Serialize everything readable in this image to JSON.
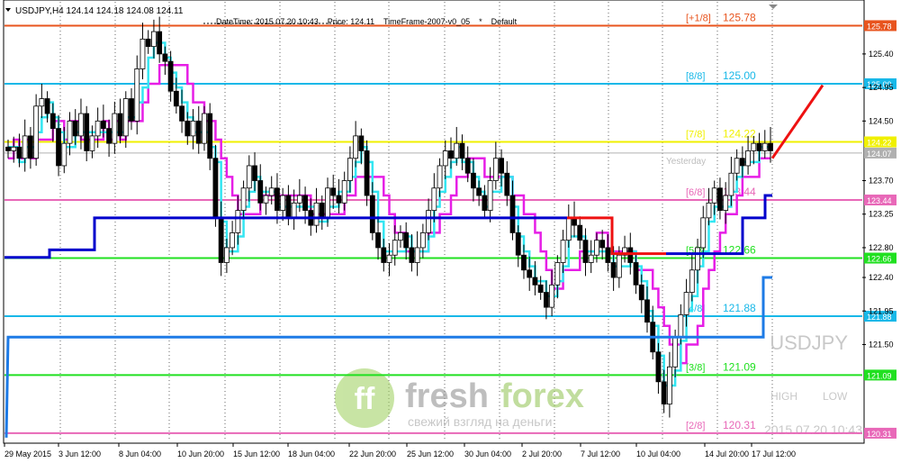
{
  "header": {
    "symbol_line": "USDJPY,H4  124.14 124.18 124.08 124.11",
    "info": "DateTime: 2015.07.20 10:43    Price: 124.11    TimeFrame-2007-v0_05    *    Default"
  },
  "watermark": {
    "symbol": "USDJPY",
    "high_label": "HIGH",
    "low_label": "LOW",
    "timestamp": "2015.07.20 10:43"
  },
  "brand": {
    "logo_text": "ff",
    "name_a": "fresh",
    "name_b": "forex",
    "tagline": "свежий взгляд на деньги"
  },
  "colors": {
    "up_candle": "#ffffff",
    "down_candle": "#000000",
    "fast_line": "#33e6f2",
    "slow_line": "#e61ee6",
    "blue_step": "#0000cc",
    "red_step": "#ee1111",
    "blue_upper": "#1e7be6",
    "projection": "#ee1111"
  },
  "chart_data": {
    "type": "candlestick",
    "symbol": "USDJPY",
    "timeframe": "H4",
    "ylim": [
      120.2,
      126.1
    ],
    "y_ticks": [
      125.4,
      124.95,
      124.5,
      123.7,
      123.25,
      122.8,
      122.4,
      121.95,
      121.5
    ],
    "x_ticks": [
      "29 May 2015",
      "3 Jun 12:00",
      "8 Jun 04:00",
      "10 Jun 20:00",
      "15 Jun 12:00",
      "18 Jun 04:00",
      "22 Jun 20:00",
      "25 Jun 12:00",
      "30 Jun 04:00",
      "2 Jul 20:00",
      "7 Jul 12:00",
      "10 Jul 04:00",
      "14 Jul 20:00",
      "17 Jul 12:00"
    ],
    "murrey_levels": [
      {
        "label": "[+1/8]",
        "value": 125.78,
        "axis_label": "125.78",
        "color": "#e8541e"
      },
      {
        "label": "[8/8]",
        "value": 125.0,
        "axis_label": "125.00",
        "color": "#18b8e8"
      },
      {
        "label": "[7/8]",
        "value": 124.22,
        "axis_label": "124.22",
        "color": "#f0f000"
      },
      {
        "label": "[6/8]",
        "value": 123.44,
        "axis_label": "123.44",
        "color": "#e868b8"
      },
      {
        "label": "[5/8]",
        "value": 122.66,
        "axis_label": "122.66",
        "color": "#20e020"
      },
      {
        "label": "[4/8]",
        "value": 121.88,
        "axis_label": "121.88",
        "color": "#18b8e8"
      },
      {
        "label": "[3/8]",
        "value": 121.09,
        "axis_label": "121.09",
        "color": "#20e020"
      },
      {
        "label": "[2/8]",
        "value": 120.31,
        "axis_label": "120.31",
        "color": "#e868b8"
      }
    ],
    "current_price": 124.07,
    "current_price_label": "124.07",
    "yesterday_label": "Yesterday",
    "closes": [
      124.1,
      124.15,
      124.0,
      124.3,
      124.0,
      124.7,
      124.8,
      124.6,
      124.4,
      123.9,
      124.2,
      124.5,
      124.3,
      124.6,
      124.1,
      124.3,
      124.5,
      124.4,
      124.2,
      124.6,
      124.3,
      124.8,
      124.5,
      125.2,
      125.6,
      125.5,
      125.7,
      125.4,
      125.3,
      124.9,
      124.7,
      124.5,
      124.3,
      124.5,
      124.2,
      124.6,
      124.0,
      123.2,
      122.6,
      122.8,
      123.0,
      123.3,
      123.6,
      123.9,
      123.7,
      123.4,
      123.5,
      123.6,
      123.3,
      123.5,
      123.2,
      123.4,
      123.5,
      123.3,
      123.1,
      123.4,
      123.2,
      123.6,
      123.5,
      123.4,
      123.7,
      124.0,
      124.3,
      124.1,
      123.5,
      123.0,
      122.8,
      122.6,
      122.7,
      122.9,
      123.0,
      122.8,
      122.6,
      122.8,
      123.0,
      123.3,
      123.6,
      123.9,
      124.1,
      124.0,
      124.2,
      124.0,
      123.8,
      123.6,
      123.5,
      123.3,
      123.7,
      124.0,
      123.8,
      123.5,
      123.0,
      122.7,
      122.5,
      122.4,
      122.3,
      122.2,
      122.0,
      122.3,
      122.6,
      122.9,
      123.2,
      123.1,
      122.9,
      122.6,
      122.7,
      122.9,
      122.8,
      122.6,
      122.4,
      122.7,
      122.8,
      122.6,
      122.3,
      122.1,
      121.8,
      121.4,
      121.0,
      120.7,
      121.2,
      121.6,
      121.9,
      122.2,
      122.5,
      122.8,
      123.2,
      123.4,
      123.6,
      123.3,
      123.5,
      123.8,
      124.0,
      123.9,
      124.1,
      124.2,
      124.1,
      124.2,
      124.1
    ]
  }
}
